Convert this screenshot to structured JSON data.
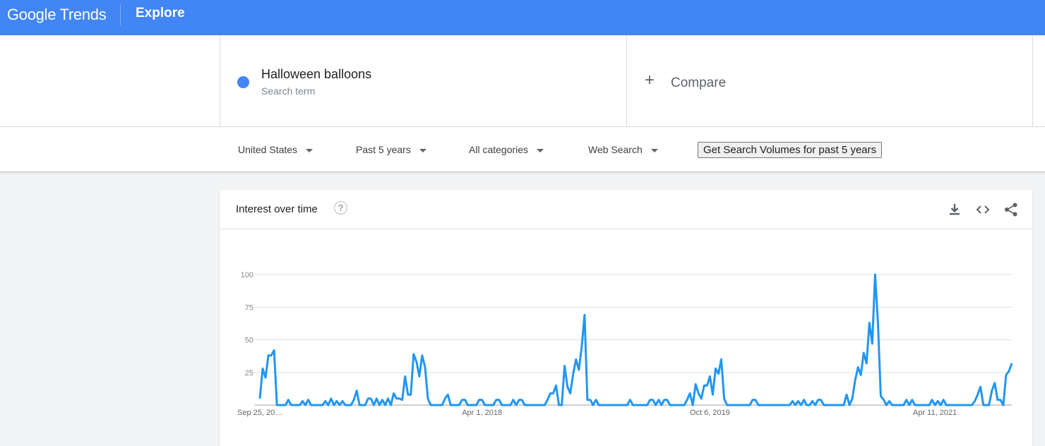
{
  "header": {
    "logo": "Google Trends",
    "nav_label": "Explore"
  },
  "search_term": {
    "label": "Halloween balloons",
    "sublabel": "Search term",
    "color": "#4285f4"
  },
  "compare": {
    "label": "Compare",
    "icon": "plus-icon"
  },
  "filters": {
    "region": "United States",
    "time": "Past 5 years",
    "category": "All categories",
    "search_type": "Web Search",
    "volume_button": "Get Search Volumes for past 5 years"
  },
  "panel": {
    "title": "Interest over time",
    "icons": [
      "help-icon",
      "download-icon",
      "embed-icon",
      "share-icon"
    ]
  },
  "chart_data": {
    "type": "line",
    "title": "",
    "xlabel": "",
    "ylabel": "",
    "ylim": [
      0,
      100
    ],
    "yticks": [
      0,
      25,
      50,
      75,
      100
    ],
    "ytick_labels": [
      "",
      "25",
      "50",
      "75",
      "100"
    ],
    "xtick_labels": [
      {
        "label": "Sep 25, 20…",
        "index": 0
      },
      {
        "label": "Apr 1, 2018",
        "index": 78
      },
      {
        "label": "Oct 6, 2019",
        "index": 158
      },
      {
        "label": "Apr 11, 2021",
        "index": 237
      }
    ],
    "grid": true,
    "series": [
      {
        "color": "#2196f3",
        "values": [
          5,
          28,
          21,
          38,
          38,
          42,
          0,
          0,
          0,
          0,
          4,
          0,
          0,
          0,
          0,
          3,
          0,
          4,
          0,
          0,
          0,
          0,
          0,
          3,
          0,
          5,
          0,
          3,
          0,
          3,
          0,
          0,
          0,
          4,
          11,
          0,
          0,
          0,
          5,
          5,
          0,
          5,
          0,
          4,
          0,
          5,
          0,
          9,
          5,
          5,
          4,
          22,
          8,
          8,
          39,
          33,
          22,
          38,
          29,
          5,
          0,
          0,
          0,
          0,
          0,
          5,
          8,
          0,
          0,
          0,
          0,
          4,
          4,
          0,
          0,
          0,
          0,
          4,
          4,
          0,
          0,
          0,
          0,
          4,
          4,
          0,
          0,
          0,
          0,
          4,
          0,
          4,
          4,
          0,
          0,
          0,
          0,
          0,
          0,
          0,
          0,
          4,
          9,
          9,
          15,
          0,
          0,
          30,
          14,
          9,
          24,
          35,
          27,
          45,
          69,
          4,
          4,
          0,
          4,
          0,
          0,
          0,
          0,
          0,
          0,
          0,
          0,
          0,
          0,
          0,
          4,
          0,
          0,
          0,
          0,
          0,
          0,
          4,
          4,
          0,
          4,
          0,
          4,
          4,
          0,
          0,
          0,
          0,
          0,
          0,
          4,
          9,
          0,
          16,
          9,
          5,
          15,
          15,
          22,
          8,
          28,
          24,
          35,
          5,
          0,
          0,
          0,
          0,
          0,
          0,
          0,
          0,
          0,
          4,
          4,
          0,
          0,
          0,
          0,
          0,
          0,
          0,
          0,
          0,
          0,
          0,
          0,
          3,
          0,
          3,
          0,
          4,
          0,
          0,
          3,
          0,
          4,
          4,
          0,
          0,
          0,
          0,
          0,
          0,
          0,
          0,
          8,
          0,
          5,
          19,
          29,
          23,
          40,
          32,
          63,
          47,
          100,
          63,
          7,
          4,
          0,
          3,
          0,
          0,
          0,
          0,
          0,
          4,
          0,
          4,
          0,
          0,
          0,
          0,
          0,
          0,
          4,
          0,
          3,
          0,
          4,
          0,
          0,
          0,
          0,
          0,
          0,
          0,
          0,
          0,
          0,
          3,
          8,
          14,
          0,
          0,
          0,
          11,
          17,
          4,
          4,
          0,
          23,
          26,
          32
        ]
      }
    ]
  }
}
